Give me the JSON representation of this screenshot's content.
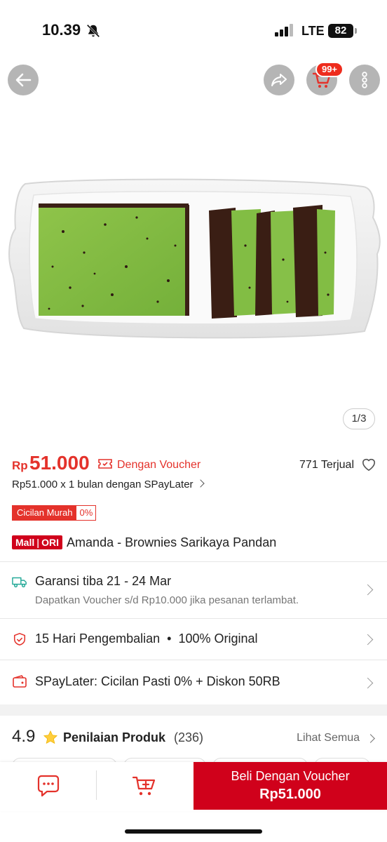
{
  "status_bar": {
    "time": "10.39",
    "network": "LTE",
    "battery": "82"
  },
  "nav": {
    "cart_badge": "99+"
  },
  "gallery": {
    "counter": "1/3"
  },
  "price": {
    "currency": "Rp",
    "value": "51.000",
    "voucher_text": "Dengan Voucher",
    "sold_text": "771 Terjual",
    "paylater_text": "Rp51.000 x 1 bulan dengan SPayLater"
  },
  "cicilan": {
    "label": "Cicilan Murah",
    "percent": "0%"
  },
  "product": {
    "badge_left": "Mall",
    "badge_right": "ORI",
    "title": "Amanda - Brownies Sarikaya Pandan"
  },
  "shipping": {
    "title": "Garansi tiba 21 - 24 Mar",
    "subtitle": "Dapatkan Voucher s/d Rp10.000 jika pesanan terlambat."
  },
  "guarantee": {
    "return_text": "15 Hari Pengembalian",
    "original_text": "100% Original"
  },
  "spaylater": {
    "text": "SPayLater: Cicilan Pasti 0% + Diskon 50RB"
  },
  "rating": {
    "score": "4.9",
    "label": "Penilaian Produk",
    "count": "(236)",
    "see_all": "Lihat Semua"
  },
  "bottom_bar": {
    "buy_label": "Beli Dengan Voucher",
    "buy_price": "Rp51.000"
  },
  "colors": {
    "accent": "#e4322b",
    "mall_red": "#d0011b",
    "teal": "#26aa99",
    "star": "#ffce3d"
  }
}
